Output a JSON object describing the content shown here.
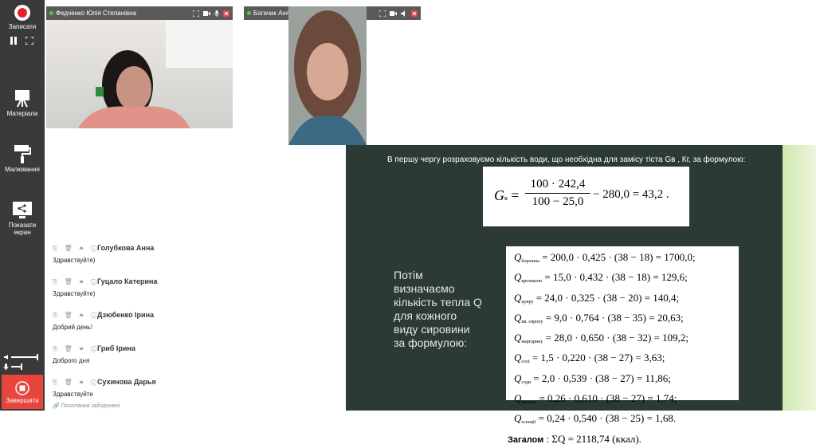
{
  "sidebar": {
    "record_label": "Записати",
    "materials_label": "Матеріали",
    "drawing_label": "Малювання",
    "share_label_1": "Показати",
    "share_label_2": "екран",
    "finish_label": "Завершити"
  },
  "videos": [
    {
      "name": "Федченко Юлія Степанівна"
    },
    {
      "name": "Богачик Аня"
    }
  ],
  "chat": {
    "messages": [
      {
        "author": "Голубкова Анна",
        "text": "Здравствуйте)"
      },
      {
        "author": "Гуцало Катерина",
        "text": "Здравствуйте)"
      },
      {
        "author": "Дзюбенко Ірина",
        "text": "Добрий день!"
      },
      {
        "author": "Гриб Ірина",
        "text": "Доброго дня"
      },
      {
        "author": "Сухинова Дарья",
        "text": "Здравствуйте"
      }
    ],
    "links_forbidden": "Посилання заборонені"
  },
  "slide": {
    "intro_text": "В першу чергу розраховуємо кількість води, що необхідна для замісу тіста Gв , Кг, за формулою:",
    "formula_g": {
      "lhs": "G",
      "lhs_sub": "в",
      "numerator": "100 · 242,4",
      "denominator": "100 − 25,0",
      "rest": "− 280,0 = 43,2 ."
    },
    "left_text": "Потім визначаємо кількість тепла Q для кожного виду сировини за формулою:",
    "q_rows": [
      {
        "sub": "борошна",
        "expr": "= 200,0 · 0,425 · (38 − 18) = 1700,0;"
      },
      {
        "sub": "крохмалю",
        "expr": "= 15,0 · 0,432 · (38 − 18) = 129,6;"
      },
      {
        "sub": "цукру",
        "expr": "= 24,0 · 0,325 · (38 − 20) = 140,4;"
      },
      {
        "sub": "ив. сиропу",
        "expr": "= 9,0 · 0,764 · (38 − 35) = 20,63;"
      },
      {
        "sub": "маргарину",
        "expr": "= 28,0 · 0,650 · (38 − 32) = 109,2;"
      },
      {
        "sub": "солі",
        "expr": "= 1,5 · 0,220 · (38 − 27) = 3,63;"
      },
      {
        "sub": "соди",
        "expr": "= 2,0 · 0,539 · (38 − 27) = 11,86;"
      },
      {
        "sub": "амонію",
        "expr": "= 0,26 · 0,610 · (38 − 27) = 1,74;"
      },
      {
        "sub": "есенції",
        "expr": "= 0,24 · 0,540 · (38 − 25) = 1,68."
      }
    ],
    "total_label": "Загалом",
    "total_expr": ": ΣQ = 2118,74 (ккал)."
  },
  "colors": {
    "sidebar_bg": "#3a3a3a",
    "record_red": "#e8202a",
    "finish_red": "#e8453c",
    "slide_bg": "#2b3a35"
  }
}
